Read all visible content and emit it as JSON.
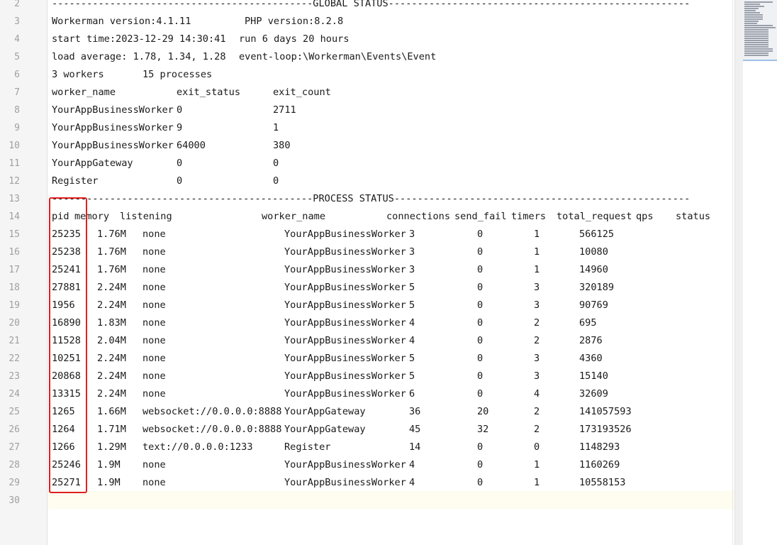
{
  "line_numbers": [
    "2",
    "3",
    "4",
    "5",
    "6",
    "7",
    "8",
    "9",
    "10",
    "11",
    "12",
    "13",
    "14",
    "15",
    "16",
    "17",
    "18",
    "19",
    "20",
    "21",
    "22",
    "23",
    "24",
    "25",
    "26",
    "27",
    "28",
    "29",
    "30"
  ],
  "global": {
    "header": "---------------------------------------------GLOBAL STATUS----------------------------------------------------",
    "workerman_version": "Workerman version:4.1.11",
    "php_version": "PHP version:8.2.8",
    "start_time": "start time:2023-12-29 14:30:41",
    "run_time": "run 6 days 20 hours",
    "load_average": "load average: 1.78, 1.34, 1.28",
    "event_loop": "event-loop:\\Workerman\\Events\\Event",
    "workers": "3 workers",
    "processes": "15 processes",
    "columns": [
      "worker_name",
      "exit_status",
      "exit_count"
    ],
    "rows": [
      [
        "YourAppBusinessWorker",
        "0",
        "2711"
      ],
      [
        "YourAppBusinessWorker",
        "9",
        "1"
      ],
      [
        "YourAppBusinessWorker",
        "64000",
        "380"
      ],
      [
        "YourAppGateway",
        "0",
        "0"
      ],
      [
        "Register",
        "0",
        "0"
      ]
    ]
  },
  "process": {
    "header": "---------------------------------------------PROCESS STATUS---------------------------------------------------",
    "columns": [
      "pid",
      "memory",
      "listening",
      "worker_name",
      "connections",
      "send_fail",
      "timers",
      "total_request",
      "qps",
      "status"
    ],
    "rows": [
      [
        "25235",
        "1.76M",
        "none",
        "YourAppBusinessWorker",
        "3",
        "0",
        "1",
        "566125"
      ],
      [
        "25238",
        "1.76M",
        "none",
        "YourAppBusinessWorker",
        "3",
        "0",
        "1",
        "10080"
      ],
      [
        "25241",
        "1.76M",
        "none",
        "YourAppBusinessWorker",
        "3",
        "0",
        "1",
        "14960"
      ],
      [
        "27881",
        "2.24M",
        "none",
        "YourAppBusinessWorker",
        "5",
        "0",
        "3",
        "320189"
      ],
      [
        "1956",
        "2.24M",
        "none",
        "YourAppBusinessWorker",
        "5",
        "0",
        "3",
        "90769"
      ],
      [
        "16890",
        "1.83M",
        "none",
        "YourAppBusinessWorker",
        "4",
        "0",
        "2",
        "695"
      ],
      [
        "11528",
        "2.04M",
        "none",
        "YourAppBusinessWorker",
        "4",
        "0",
        "2",
        "2876"
      ],
      [
        "10251",
        "2.24M",
        "none",
        "YourAppBusinessWorker",
        "5",
        "0",
        "3",
        "4360"
      ],
      [
        "20868",
        "2.24M",
        "none",
        "YourAppBusinessWorker",
        "5",
        "0",
        "3",
        "15140"
      ],
      [
        "13315",
        "2.24M",
        "none",
        "YourAppBusinessWorker",
        "6",
        "0",
        "4",
        "32609"
      ],
      [
        "1265",
        "1.66M",
        "websocket://0.0.0.0:8888",
        "YourAppGateway",
        "36",
        "20",
        "2",
        "141057593"
      ],
      [
        "1264",
        "1.71M",
        "websocket://0.0.0.0:8888",
        "YourAppGateway",
        "45",
        "32",
        "2",
        "173193526"
      ],
      [
        "1266",
        "1.29M",
        "text://0.0.0.0:1233",
        "Register",
        "14",
        "0",
        "0",
        "1148293"
      ],
      [
        "25246",
        "1.9M",
        "none",
        "YourAppBusinessWorker",
        "4",
        "0",
        "1",
        "1160269"
      ],
      [
        "25271",
        "1.9M",
        "none",
        "YourAppBusinessWorker",
        "4",
        "0",
        "1",
        "10558153"
      ]
    ]
  },
  "colors": {
    "highlight_box": "#e02020",
    "current_line": "#fefdf0",
    "gutter_bg": "#f5f5f5"
  }
}
